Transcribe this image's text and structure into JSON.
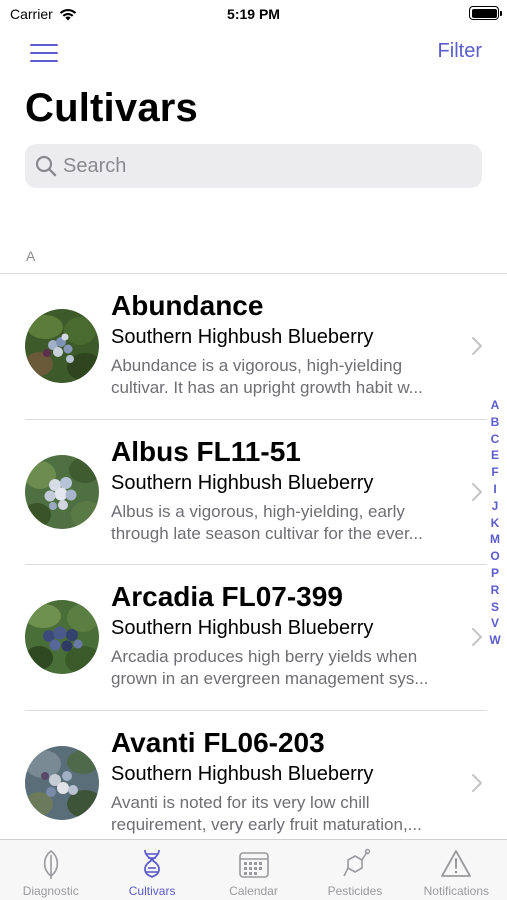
{
  "status_bar": {
    "carrier": "Carrier",
    "time": "5:19 PM"
  },
  "nav": {
    "filter_label": "Filter",
    "title": "Cultivars"
  },
  "search": {
    "placeholder": "Search"
  },
  "section": {
    "letter": "A"
  },
  "cultivars": [
    {
      "name": "Abundance",
      "type": "Southern Highbush Blueberry",
      "description": "Abundance is a vigorous, high-yielding cultivar. It has an upright growth habit w..."
    },
    {
      "name": "Albus FL11-51",
      "type": "Southern Highbush Blueberry",
      "description": "Albus is a vigorous, high-yielding, early through late season cultivar for the ever..."
    },
    {
      "name": "Arcadia FL07-399",
      "type": "Southern Highbush Blueberry",
      "description": "Arcadia produces high berry yields when grown in an evergreen management sys..."
    },
    {
      "name": "Avanti FL06-203",
      "type": "Southern Highbush Blueberry",
      "description": "Avanti is noted for its very low chill requirement, very early fruit maturation,..."
    }
  ],
  "index_letters": [
    "A",
    "B",
    "C",
    "E",
    "F",
    "I",
    "J",
    "K",
    "M",
    "O",
    "P",
    "R",
    "S",
    "V",
    "W"
  ],
  "tabs": [
    {
      "label": "Diagnostic",
      "icon": "leaf-icon"
    },
    {
      "label": "Cultivars",
      "icon": "dna-icon",
      "active": true
    },
    {
      "label": "Calendar",
      "icon": "calendar-icon"
    },
    {
      "label": "Pesticides",
      "icon": "molecule-icon"
    },
    {
      "label": "Notifications",
      "icon": "warning-icon"
    }
  ],
  "colors": {
    "accent": "#5c5ccc",
    "inactive": "#9a9a9e",
    "secondary_text": "#6e6e73",
    "search_bg": "#ececee"
  }
}
